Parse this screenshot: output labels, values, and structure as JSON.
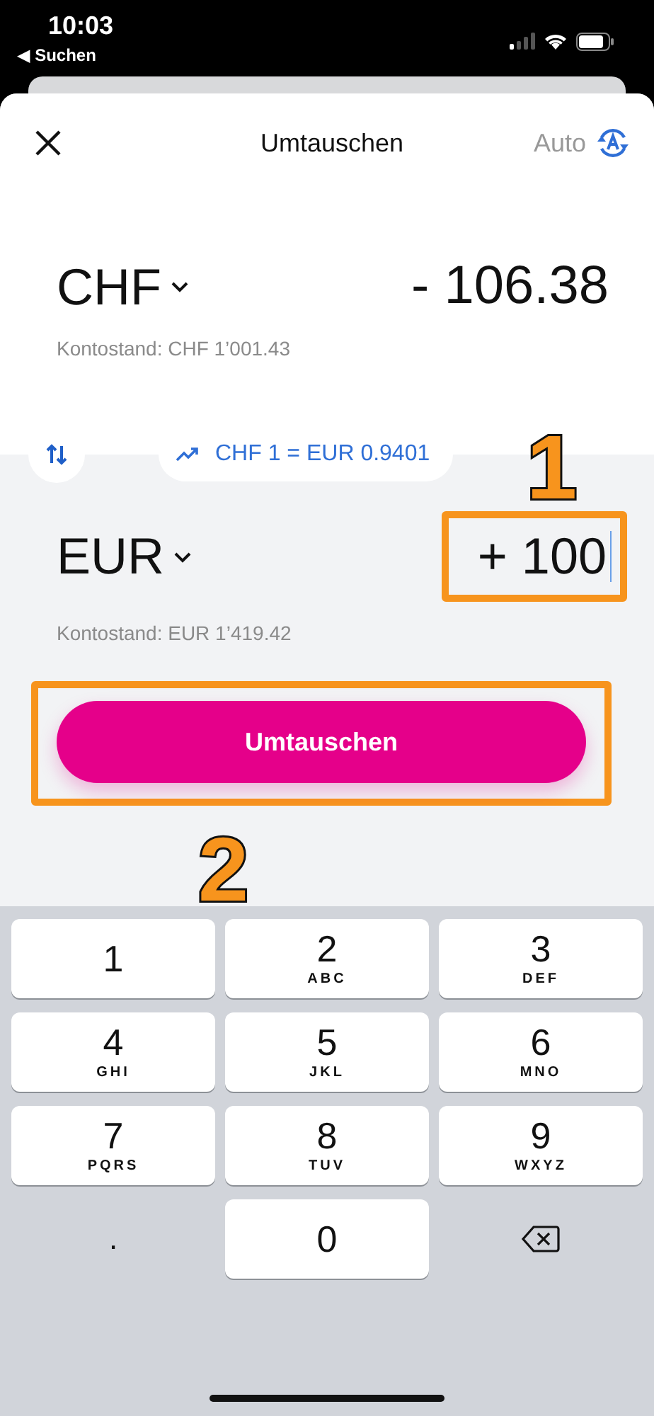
{
  "status_bar": {
    "time": "10:03",
    "back_link": "◀ Suchen"
  },
  "header": {
    "title": "Umtauschen",
    "auto_label": "Auto"
  },
  "from": {
    "currency": "CHF",
    "amount": "- 106.38",
    "balance": "Kontostand: CHF 1’001.43"
  },
  "rate": {
    "text": "CHF 1 = EUR 0.9401"
  },
  "to": {
    "currency": "EUR",
    "amount": "+ 100",
    "balance": "Kontostand: EUR 1’419.42"
  },
  "submit_button": {
    "label": "Umtauschen"
  },
  "annotations": [
    {
      "number": "1",
      "kind": "field"
    },
    {
      "number": "2",
      "kind": "button"
    }
  ],
  "keypad": [
    {
      "kind": "digit",
      "digit": "1"
    },
    {
      "kind": "digit",
      "digit": "2",
      "letters": "ABC"
    },
    {
      "kind": "digit",
      "digit": "3",
      "letters": "DEF"
    },
    {
      "kind": "digit",
      "digit": "4",
      "letters": "GHI"
    },
    {
      "kind": "digit",
      "digit": "5",
      "letters": "JKL"
    },
    {
      "kind": "digit",
      "digit": "6",
      "letters": "MNO"
    },
    {
      "kind": "digit",
      "digit": "7",
      "letters": "PQRS"
    },
    {
      "kind": "digit",
      "digit": "8",
      "letters": "TUV"
    },
    {
      "kind": "digit",
      "digit": "9",
      "letters": "WXYZ"
    },
    {
      "kind": "dot",
      "digit": "."
    },
    {
      "kind": "digit",
      "digit": "0"
    },
    {
      "kind": "delete"
    }
  ]
}
